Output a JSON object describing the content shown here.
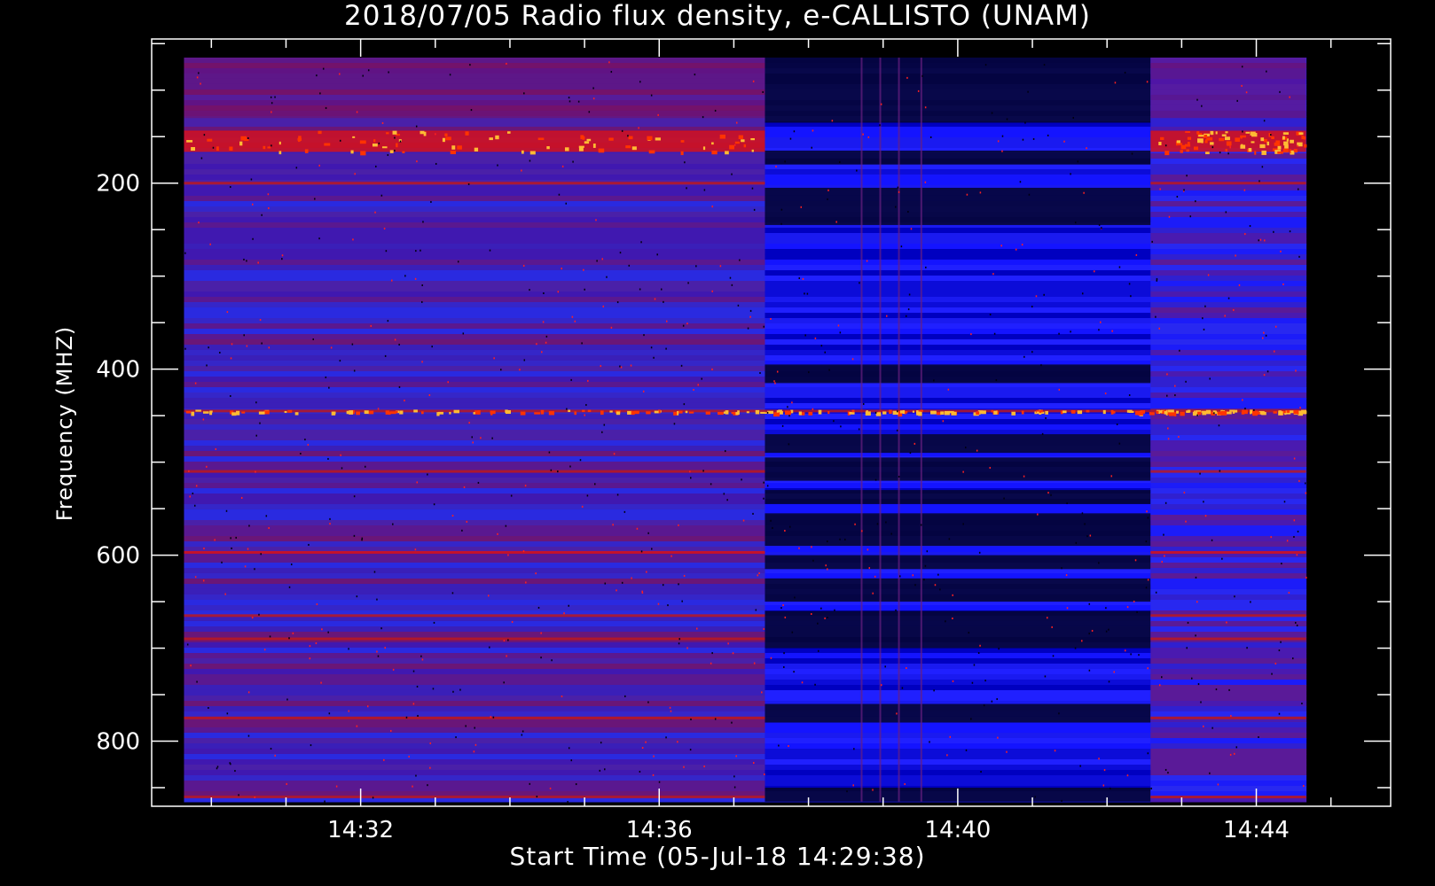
{
  "chart_data": {
    "type": "heatmap",
    "title": "2018/07/05  Radio flux density, e-CALLISTO (UNAM)",
    "xlabel": "Start Time (05-Jul-18 14:29:38)",
    "ylabel": "Frequency (MHZ)",
    "x_ticks": [
      "14:32",
      "14:36",
      "14:40",
      "14:44"
    ],
    "x_tick_minutes": [
      32,
      36,
      40,
      44
    ],
    "y_ticks": [
      "200",
      "400",
      "600",
      "800"
    ],
    "y_tick_values": [
      200,
      400,
      600,
      800
    ],
    "xlim_minutes": [
      29.2,
      45.8
    ],
    "data_x_range_minutes": [
      29.63,
      44.67
    ],
    "ylim": [
      45,
      870
    ],
    "y_reversed": true,
    "data_y_range": [
      65,
      865
    ],
    "segments": [
      {
        "name": "segment-1",
        "start": "14:29:38",
        "end": "14:37:25",
        "level": "warm"
      },
      {
        "name": "segment-2",
        "start": "14:37:25",
        "end": "14:42:35",
        "level": "cold"
      },
      {
        "name": "segment-3",
        "start": "14:42:35",
        "end": "14:44:40",
        "level": "mixed"
      }
    ],
    "emission_bands_mhz": [
      155,
      200,
      445,
      510,
      597,
      665,
      690,
      775,
      860
    ],
    "colormap": [
      "#000000",
      "#0000ff",
      "#aa0000",
      "#ff0000",
      "#ff9900",
      "#ffff66"
    ],
    "grid": false
  }
}
